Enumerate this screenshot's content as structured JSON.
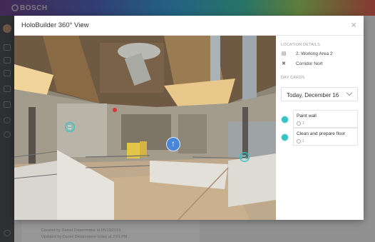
{
  "app": {
    "brand": "BOSCH",
    "meta_created": "Created by Daniel Dissenmeier at 05/19/2016",
    "meta_updated": "Updated by Daniel Dissenmeier today at 2:01 PM"
  },
  "modal": {
    "title": "HoloBuilder 360° View",
    "close_label": "×"
  },
  "viewer": {
    "nav_arrow": "↑"
  },
  "panel": {
    "location_label": "LOCATION DETAILS",
    "location_items": [
      {
        "icon": "floorplan-icon",
        "text": "2. Working Area 2"
      },
      {
        "icon": "crane-icon",
        "text": "Corridor Nort"
      }
    ],
    "day_cards_label": "DAY CARDS",
    "date_value": "Today, December 16",
    "cards": [
      {
        "title": "Paint wall",
        "count": "1"
      },
      {
        "title": "Clean and prepare floor",
        "count": "1"
      }
    ]
  },
  "colors": {
    "accent": "#37c3c3",
    "nav_arrow": "#4a86d8"
  }
}
